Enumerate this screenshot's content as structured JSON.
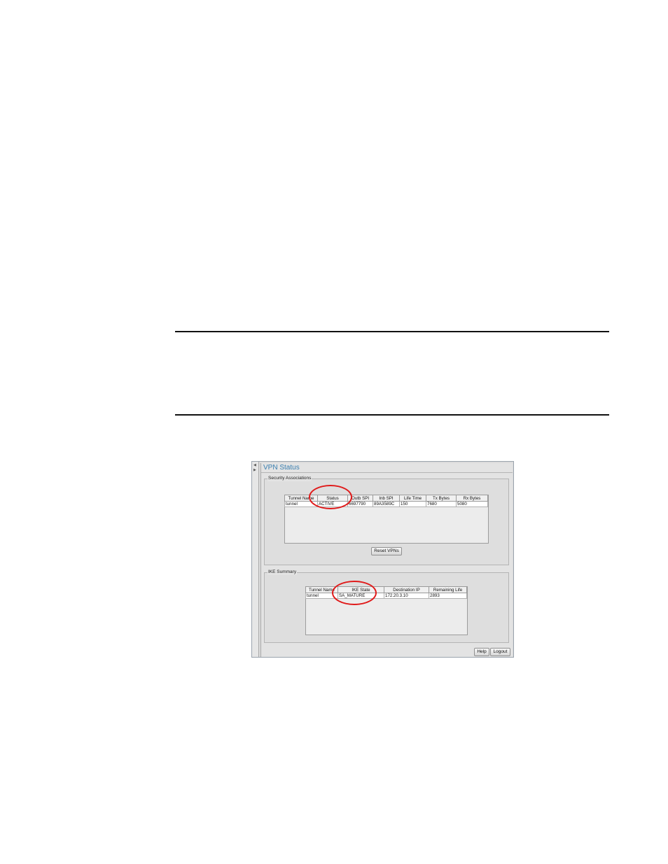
{
  "window": {
    "title": "VPN Status"
  },
  "security_associations": {
    "legend": "Security Associations",
    "columns": [
      "Tunnel Name",
      "Status",
      "Outb SPI",
      "Inb SPI",
      "Life Time",
      "Tx Bytes",
      "Rx Bytes"
    ],
    "rows": [
      [
        "tunnel",
        "ACTIVE",
        "6697790",
        "89A3589C",
        "150",
        "7680",
        "5080"
      ]
    ],
    "reset_label": "Reset VPNs"
  },
  "ike_summary": {
    "legend": "IKE Summary",
    "columns": [
      "Tunnel Name",
      "IKE State",
      "Destination IP",
      "Remaining Life"
    ],
    "rows": [
      [
        "tunnel",
        "SA_MATURE",
        "172.20.3.10",
        "2893"
      ]
    ]
  },
  "footer": {
    "help_label": "Help",
    "logout_label": "Logout"
  },
  "annotations": {
    "highlight_color": "#e01a1a"
  }
}
